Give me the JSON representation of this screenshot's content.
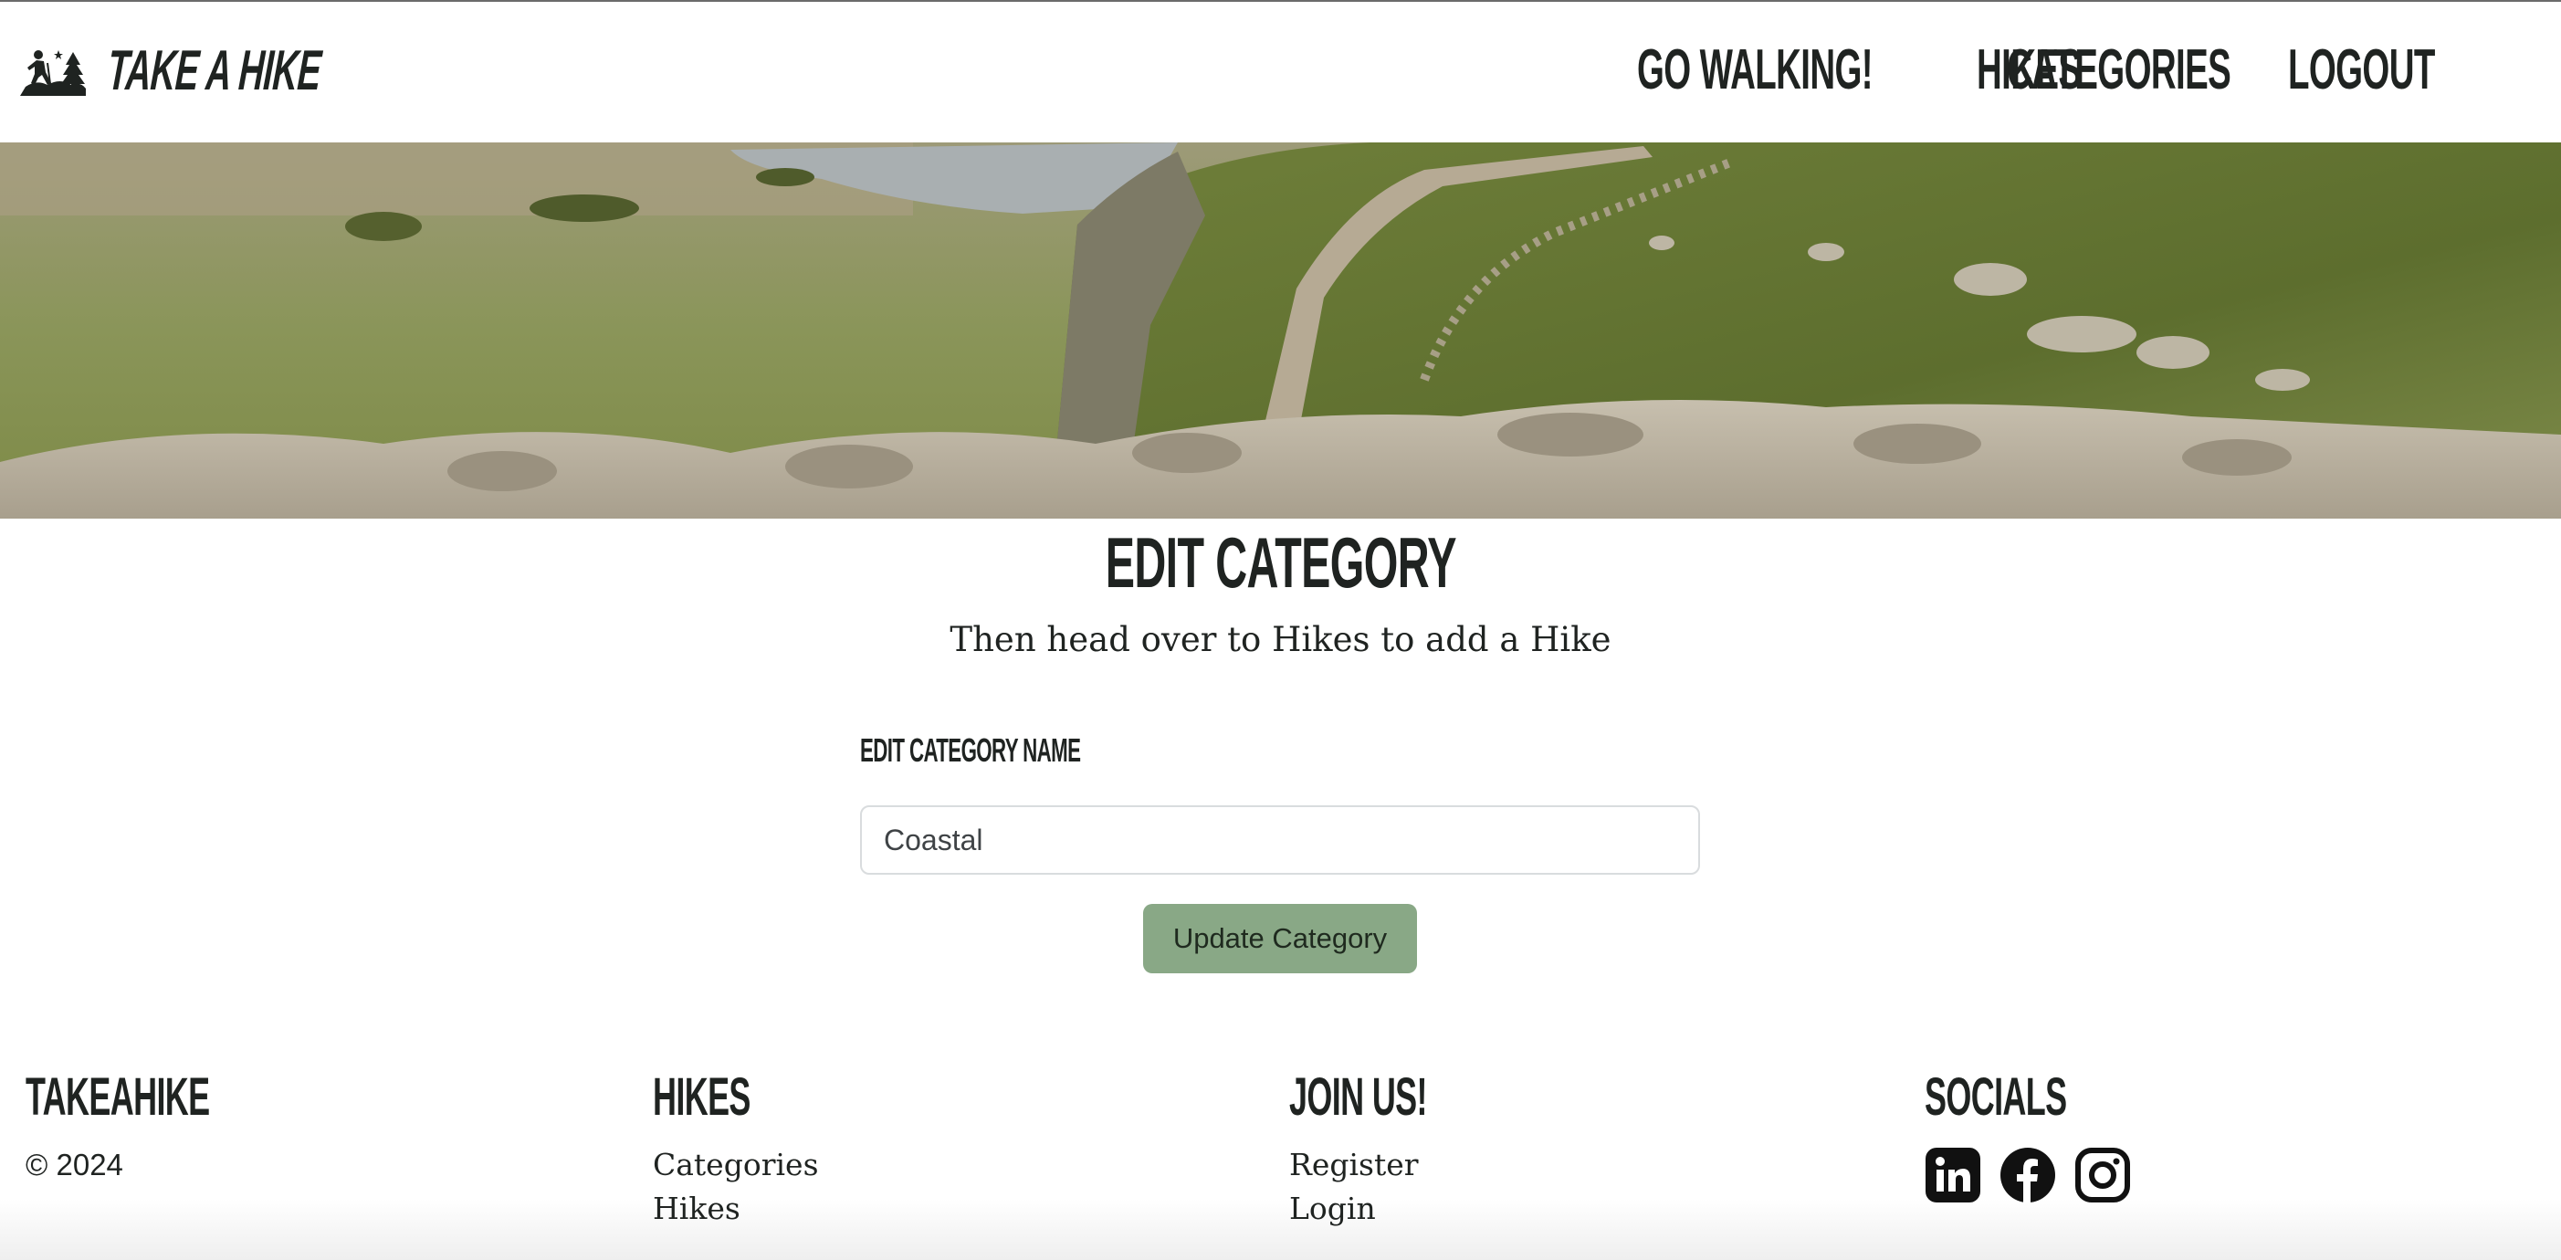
{
  "header": {
    "brand": "TAKE A HIKE",
    "nav": [
      "GO WALKING!",
      "HIKES",
      "CATEGORIES",
      "LOGOUT"
    ]
  },
  "main": {
    "title": "EDIT CATEGORY",
    "subtitle": "Then head over to Hikes to add a Hike",
    "field_label": "EDIT CATEGORY NAME",
    "field_value": "Coastal",
    "submit_label": "Update Category"
  },
  "footer": {
    "brand": "TAKEAHIKE",
    "copyright": "© 2024",
    "hikes_heading": "HIKES",
    "hikes_links": [
      "Categories",
      "Hikes"
    ],
    "join_heading": "JOIN US!",
    "join_links": [
      "Register",
      "Login"
    ],
    "socials_heading": "SOCIALS",
    "socials": [
      "linkedin-icon",
      "facebook-icon",
      "instagram-icon"
    ]
  },
  "colors": {
    "button": "#89a886",
    "text": "#1f2321",
    "input_border": "#d9dcde"
  }
}
